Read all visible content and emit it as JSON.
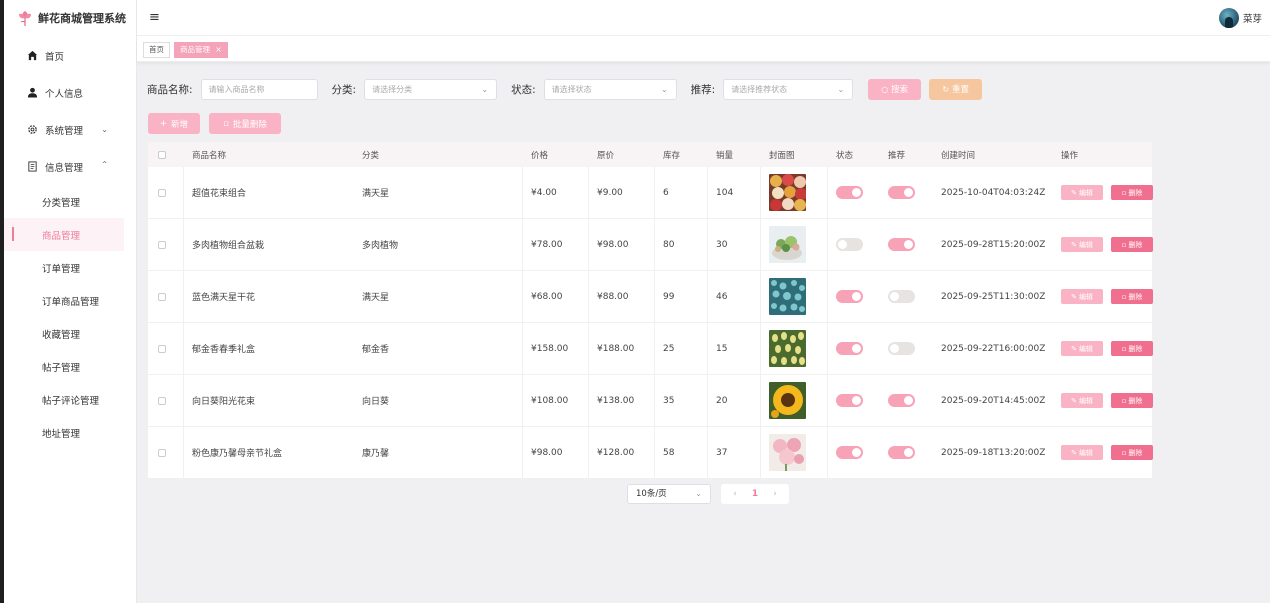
{
  "app": {
    "title": "鲜花商城管理系统",
    "username": "菜芽"
  },
  "sidebar": {
    "items": [
      {
        "label": "首页",
        "icon": "home-icon"
      },
      {
        "label": "个人信息",
        "icon": "user-icon"
      },
      {
        "label": "系统管理",
        "icon": "gear-icon"
      },
      {
        "label": "信息管理",
        "icon": "document-icon"
      }
    ],
    "subitems": [
      "分类管理",
      "商品管理",
      "订单管理",
      "订单商品管理",
      "收藏管理",
      "帖子管理",
      "帖子评论管理",
      "地址管理"
    ]
  },
  "tabs": {
    "home": "首页",
    "active": "商品管理",
    "close": "×"
  },
  "filters": {
    "name_label": "商品名称:",
    "name_placeholder": "请输入商品名称",
    "category_label": "分类:",
    "category_placeholder": "请选择分类",
    "status_label": "状态:",
    "status_placeholder": "请选择状态",
    "recommend_label": "推荐:",
    "recommend_placeholder": "请选择推荐状态",
    "search_label": "搜索",
    "reset_label": "重置"
  },
  "actions": {
    "add_label": "新增",
    "batch_delete_label": "批量删除"
  },
  "table": {
    "headers": {
      "name": "商品名称",
      "category": "分类",
      "price": "价格",
      "original_price": "原价",
      "stock": "库存",
      "sales": "销量",
      "cover": "封面图",
      "status": "状态",
      "recommend": "推荐",
      "created": "创建时间",
      "operation": "操作"
    },
    "edit_label": "编辑",
    "delete_label": "删除",
    "rows": [
      {
        "name": "超值花束组合",
        "category": "满天星",
        "price": "¥4.00",
        "original_price": "¥9.00",
        "stock": "6",
        "sales": "104",
        "status": true,
        "recommend": true,
        "created": "2025-10-04T04:03:24Z",
        "cover": "mixed-roses"
      },
      {
        "name": "多肉植物组合盆栽",
        "category": "多肉植物",
        "price": "¥78.00",
        "original_price": "¥98.00",
        "stock": "80",
        "sales": "30",
        "status": false,
        "recommend": true,
        "created": "2025-09-28T15:20:00Z",
        "cover": "succulent"
      },
      {
        "name": "蓝色满天星干花",
        "category": "满天星",
        "price": "¥68.00",
        "original_price": "¥88.00",
        "stock": "99",
        "sales": "46",
        "status": true,
        "recommend": false,
        "created": "2025-09-25T11:30:00Z",
        "cover": "blue-flowers"
      },
      {
        "name": "郁金香春季礼盒",
        "category": "郁金香",
        "price": "¥158.00",
        "original_price": "¥188.00",
        "stock": "25",
        "sales": "15",
        "status": true,
        "recommend": false,
        "created": "2025-09-22T16:00:00Z",
        "cover": "tulips"
      },
      {
        "name": "向日葵阳光花束",
        "category": "向日葵",
        "price": "¥108.00",
        "original_price": "¥138.00",
        "stock": "35",
        "sales": "20",
        "status": true,
        "recommend": true,
        "created": "2025-09-20T14:45:00Z",
        "cover": "sunflower"
      },
      {
        "name": "粉色康乃馨母亲节礼盒",
        "category": "康乃馨",
        "price": "¥98.00",
        "original_price": "¥128.00",
        "stock": "58",
        "sales": "37",
        "status": true,
        "recommend": true,
        "created": "2025-09-18T13:20:00Z",
        "cover": "carnation"
      }
    ]
  },
  "pagination": {
    "page_size": "10条/页",
    "current_page": "1",
    "prev": "‹",
    "next": "›"
  },
  "colors": {
    "accent": "#f07c9c",
    "accent_light": "#f9b3c4",
    "reset": "#f6c79e"
  }
}
